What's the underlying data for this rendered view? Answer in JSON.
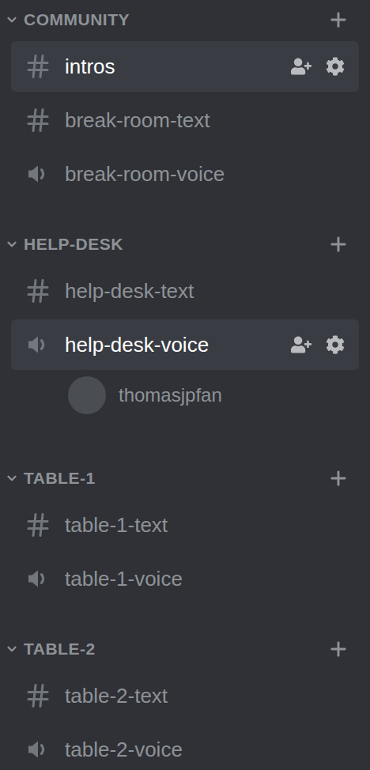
{
  "sidebar": {
    "categories": [
      {
        "name": "COMMUNITY",
        "expanded": true,
        "channels": [
          {
            "name": "intros",
            "kind": "text",
            "selected": true,
            "users": []
          },
          {
            "name": "break-room-text",
            "kind": "text",
            "selected": false,
            "users": []
          },
          {
            "name": "break-room-voice",
            "kind": "voice",
            "selected": false,
            "users": []
          }
        ]
      },
      {
        "name": "HELP-DESK",
        "expanded": true,
        "channels": [
          {
            "name": "help-desk-text",
            "kind": "text",
            "selected": false,
            "users": []
          },
          {
            "name": "help-desk-voice",
            "kind": "voice",
            "selected": true,
            "users": [
              {
                "name": "thomasjpfan"
              }
            ]
          }
        ]
      },
      {
        "name": "TABLE-1",
        "expanded": true,
        "channels": [
          {
            "name": "table-1-text",
            "kind": "text",
            "selected": false,
            "users": []
          },
          {
            "name": "table-1-voice",
            "kind": "voice",
            "selected": false,
            "users": []
          }
        ]
      },
      {
        "name": "TABLE-2",
        "expanded": true,
        "channels": [
          {
            "name": "table-2-text",
            "kind": "text",
            "selected": false,
            "users": []
          },
          {
            "name": "table-2-voice",
            "kind": "voice",
            "selected": false,
            "users": []
          }
        ]
      }
    ]
  }
}
